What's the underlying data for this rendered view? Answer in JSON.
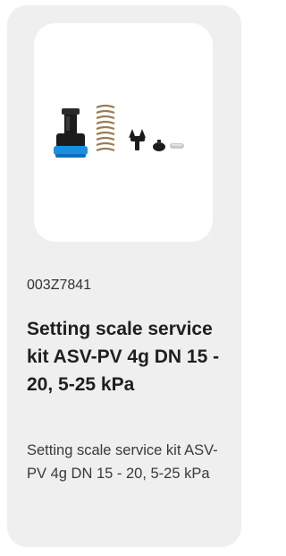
{
  "product": {
    "image_icon": "service-kit-parts-image",
    "sku": "003Z7841",
    "title": "Setting scale service kit ASV-PV 4g DN 15 - 20, 5-25 kPa",
    "description": "Setting scale service kit ASV-PV 4g DN 15 - 20, 5-25 kPa"
  },
  "colors": {
    "card_background": "#efefef",
    "image_background": "#ffffff",
    "accent_blue": "#1a8fe0",
    "part_black": "#1c1c1c",
    "spring_bronze": "#9a7d55",
    "washer_silver": "#c9c9c9"
  }
}
